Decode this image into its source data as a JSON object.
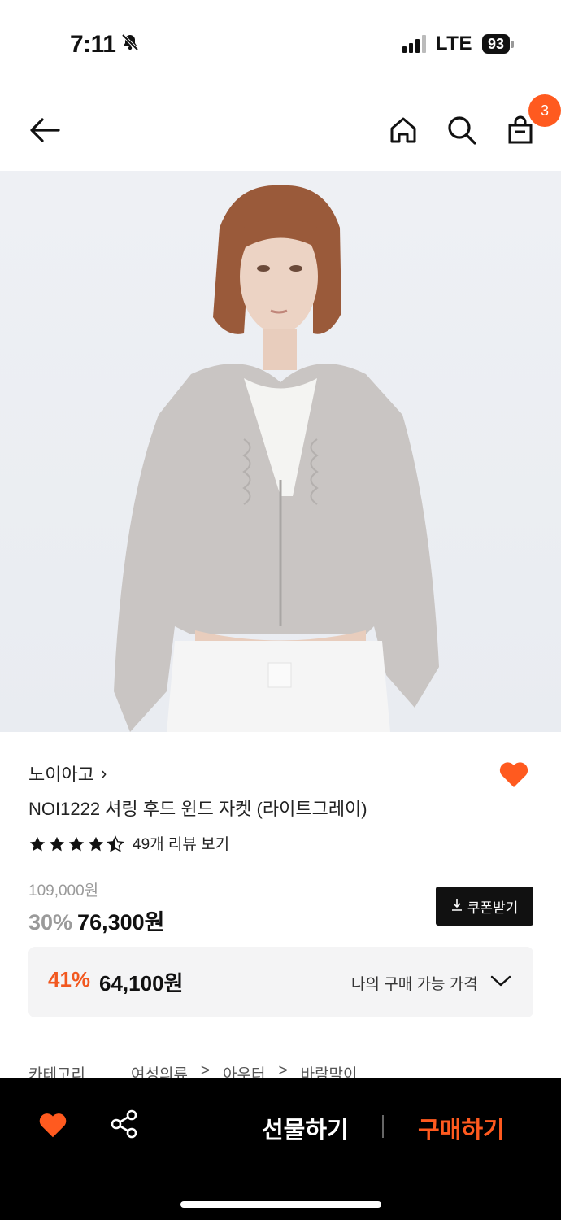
{
  "status": {
    "time": "7:11",
    "network": "LTE",
    "battery": "93"
  },
  "header": {
    "cart_count": "3"
  },
  "product": {
    "brand": "노이아고",
    "brand_chevron": "›",
    "title": "NOI1222 셔링 후드 윈드 자켓 (라이트그레이)",
    "rating_value": 4.5,
    "review_link": "49개 리뷰 보기",
    "original_price": "109,000원",
    "discount_rate": "30%",
    "sale_price": "76,300원",
    "coupon_label": "쿠폰받기"
  },
  "best_price": {
    "rate": "41%",
    "price": "64,100원",
    "label": "나의 구매 가능 가격"
  },
  "category": {
    "label": "카테고리",
    "path": [
      "여성의류",
      ">",
      "아우터",
      ">",
      "바람막이"
    ]
  },
  "bottom_bar": {
    "gift_label": "선물하기",
    "buy_label": "구매하기"
  },
  "colors": {
    "accent": "#ff5a1f",
    "dark": "#111111"
  },
  "icons": [
    "bell-off-icon",
    "back-arrow-icon",
    "home-icon",
    "search-icon",
    "cart-icon",
    "chevron-right-icon",
    "heart-icon",
    "star-icon",
    "download-icon",
    "chevron-down-icon",
    "share-icon"
  ]
}
